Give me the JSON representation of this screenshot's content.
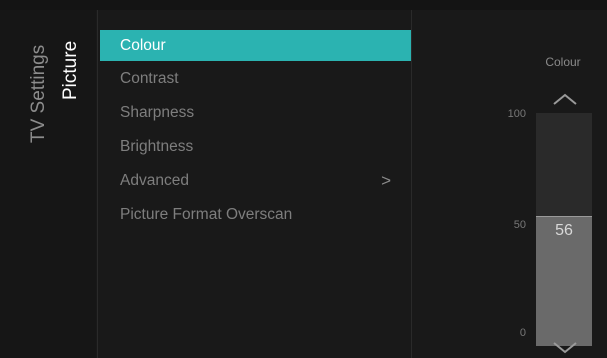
{
  "breadcrumb": {
    "root": "TV Settings",
    "current": "Picture"
  },
  "menu": {
    "items": [
      {
        "label": "Colour",
        "selected": true,
        "has_submenu": false
      },
      {
        "label": "Contrast",
        "selected": false,
        "has_submenu": false
      },
      {
        "label": "Sharpness",
        "selected": false,
        "has_submenu": false
      },
      {
        "label": "Brightness",
        "selected": false,
        "has_submenu": false
      },
      {
        "label": "Advanced",
        "selected": false,
        "has_submenu": true
      },
      {
        "label": "Picture Format Overscan",
        "selected": false,
        "has_submenu": false
      }
    ],
    "submenu_glyph": ">"
  },
  "slider": {
    "title": "Colour",
    "max_label": "100",
    "mid_label": "50",
    "min_label": "0",
    "min": 0,
    "max": 100,
    "value": 56,
    "value_text": "56"
  },
  "icons": {
    "up": "chevron-up-icon",
    "down": "chevron-down-icon",
    "submenu": "chevron-right-icon"
  },
  "colors": {
    "accent": "#2bb3b1",
    "background": "#191919",
    "slider_fill": "#6a6a6a",
    "slider_track": "#2a2a2a"
  }
}
